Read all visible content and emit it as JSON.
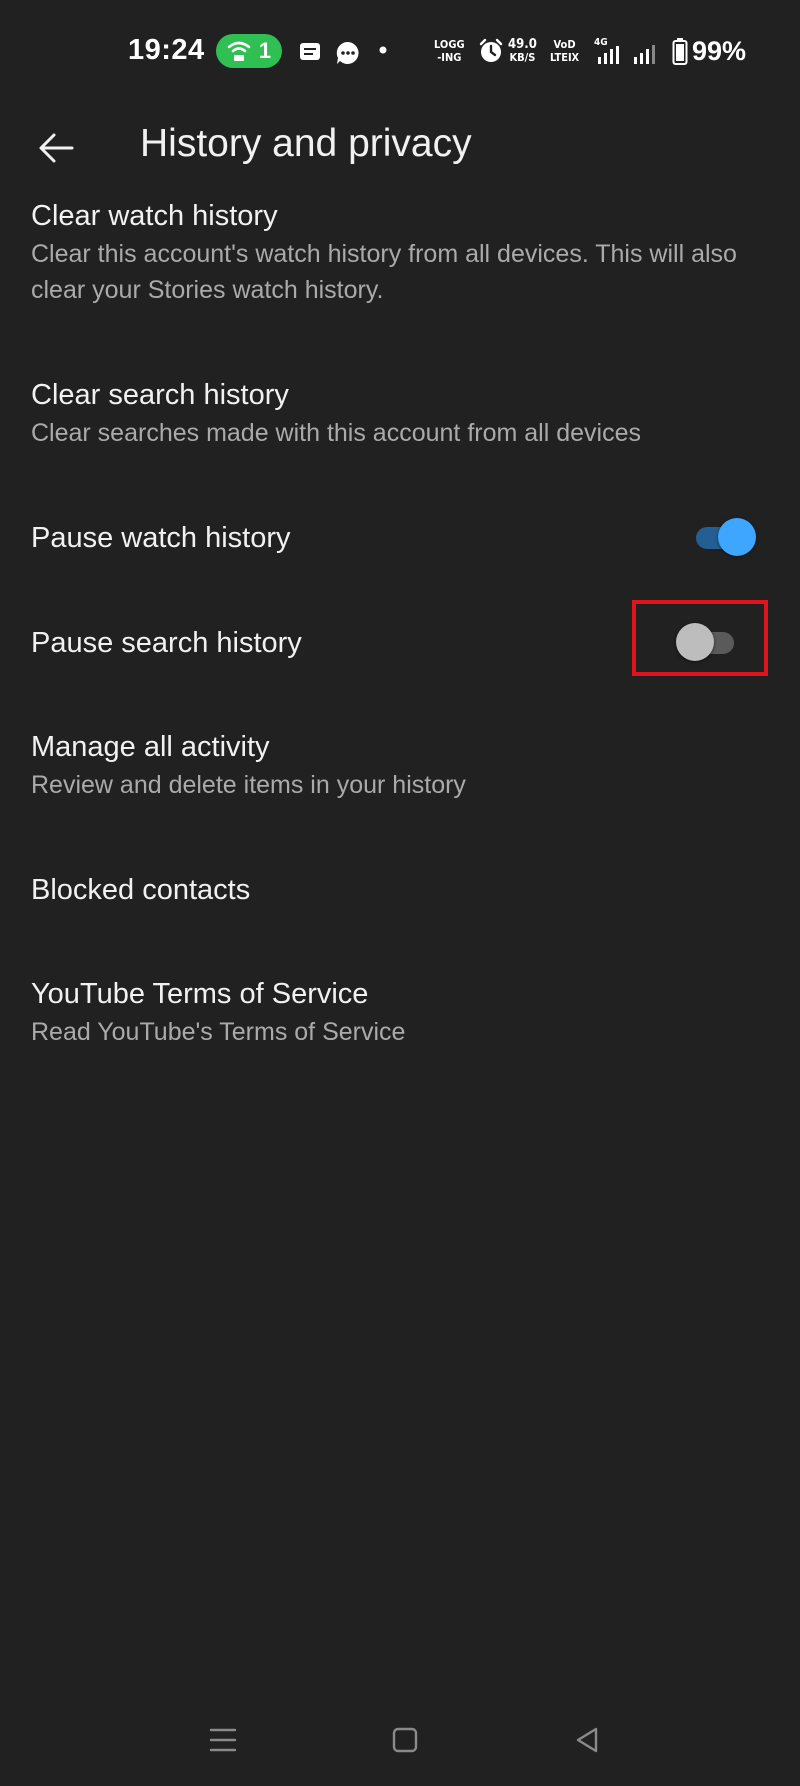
{
  "status_bar": {
    "time": "19:24",
    "hotspot_count": "1",
    "net_speed": [
      "49.0",
      "KB/S"
    ],
    "logging": [
      "LOGG",
      "-ING"
    ],
    "volte": [
      "VoD",
      "LTEⅨ"
    ],
    "network_type": "4G",
    "battery": "99%",
    "icons": [
      "hotspot-icon",
      "message-icon",
      "chat-icon",
      "dot-icon",
      "alarm-icon",
      "signal-icon",
      "battery-icon"
    ]
  },
  "app_bar": {
    "title": "History and privacy",
    "back_icon": "arrow-back-icon"
  },
  "settings": [
    {
      "title": "Clear watch history",
      "subtitle": "Clear this account's watch history from all devices. This will also clear your Stories watch history."
    },
    {
      "title": "Clear search history",
      "subtitle": "Clear searches made with this account from all devices"
    },
    {
      "title": "Pause watch history",
      "toggle_on": true
    },
    {
      "title": "Pause search history",
      "toggle_on": false
    },
    {
      "title": "Manage all activity",
      "subtitle": "Review and delete items in your history"
    },
    {
      "title": "Blocked contacts"
    },
    {
      "title": "YouTube Terms of Service",
      "subtitle": "Read YouTube's Terms of Service"
    }
  ],
  "nav_bar": {
    "icons": [
      "recents-icon",
      "home-icon",
      "back-triangle-icon"
    ]
  },
  "colors": {
    "background": "#212121",
    "toggle_on_thumb": "#3ea6ff",
    "toggle_on_track": "#245f93",
    "toggle_off_thumb": "#bdbdbd",
    "toggle_off_track": "#5a5a5a",
    "highlight": "#e0141e",
    "hotspot_pill": "#2fbf53"
  }
}
